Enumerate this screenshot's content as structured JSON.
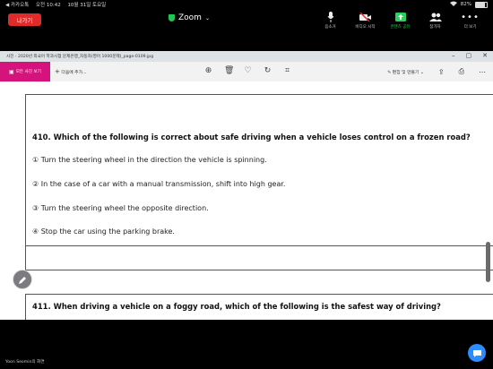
{
  "status_bar": {
    "back_app": "◀ 카카오톡",
    "time": "오전 10:42",
    "date": "10월 31일 토요일",
    "battery": "82%",
    "battery_level": 0.82
  },
  "zoom": {
    "leave_label": "나가기",
    "title": "Zoom",
    "controls": [
      {
        "label": "음소거"
      },
      {
        "label": "비디오 시작"
      },
      {
        "label": "콘텐츠 공유"
      },
      {
        "label": "참가자"
      },
      {
        "label": "더 보기"
      }
    ],
    "accent": "#2bd15a",
    "leave_color": "#e02b2b"
  },
  "photo_window": {
    "title": "사진 - 2020년 외국어 학과시험 문제은행_자동차(영어 1000문제)_page-0109.jpg",
    "all_photos_label": "모든 사진 보기",
    "add_to_label": "다음에 추가...",
    "edit_label": "편집 및 만들기",
    "brand_color": "#d4147c"
  },
  "document": {
    "q410": "410. Which of the following is correct about safe driving when a vehicle loses control on a frozen road?",
    "options": [
      "① Turn the steering wheel in the direction the vehicle is spinning.",
      "② In the case of a car with a manual transmission, shift into high gear.",
      "③ Turn the steering wheel the opposite direction.",
      "④ Stop the car using the parking brake."
    ],
    "q411": "411. When driving a vehicle on a foggy road, which of the following is the safest way of driving?"
  },
  "footer": {
    "speaker": "Yoon Seomin의 화면"
  }
}
